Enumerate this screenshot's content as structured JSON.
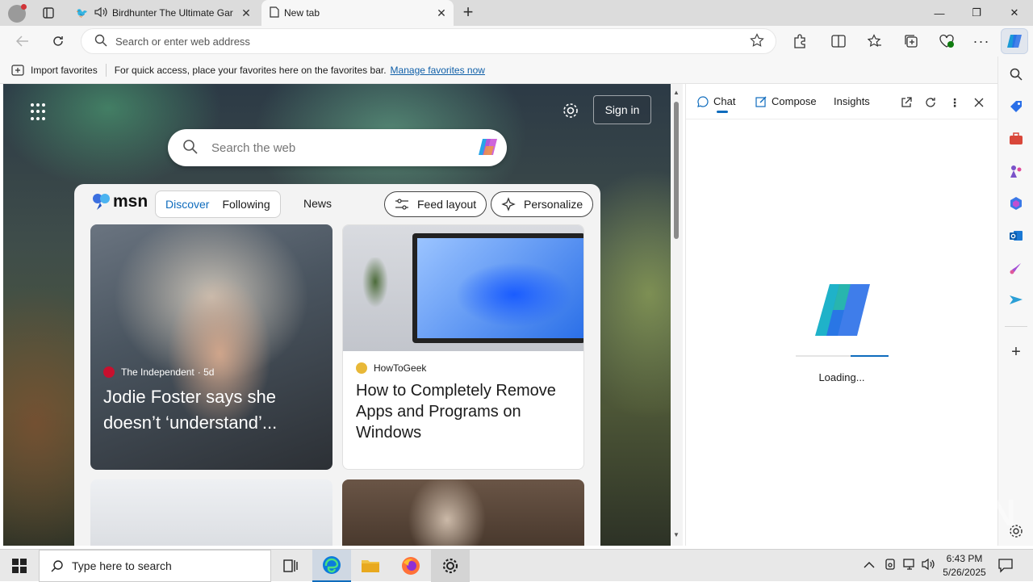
{
  "tabs": [
    {
      "title": "Birdhunter The Ultimate Gar",
      "close": "✕"
    },
    {
      "title": "New tab",
      "close": "✕"
    }
  ],
  "window_controls": {
    "minimize": "—",
    "restore": "❐",
    "close": "✕"
  },
  "new_tab_symbol": "+",
  "address_bar": {
    "placeholder": "Search or enter web address"
  },
  "favorites_bar": {
    "import_label": "Import favorites",
    "hint": "For quick access, place your favorites here on the favorites bar.",
    "manage_link": "Manage favorites now"
  },
  "newtab": {
    "signin": "Sign in",
    "search_placeholder": "Search the web",
    "msn_brand": "msn",
    "tabs": [
      "Discover",
      "Following"
    ],
    "news_tab": "News",
    "feed_layout": "Feed layout",
    "personalize": "Personalize",
    "cards": [
      {
        "source": "The Independent",
        "age": "· 5d",
        "headline": "Jodie Foster says she doesn’t ‘understand’..."
      },
      {
        "source": "HowToGeek",
        "headline": "How to Completely Remove Apps and Programs on Windows"
      }
    ]
  },
  "copilot_pane": {
    "tabs": [
      "Chat",
      "Compose",
      "Insights"
    ],
    "loading_text": "Loading...",
    "loading_progress": 0.41
  },
  "taskbar": {
    "search_placeholder": "Type here to search",
    "time": "6:43 PM",
    "date": "5/26/2025"
  },
  "watermark": "ANY RUN",
  "colors": {
    "accent": "#0f6cbd",
    "tabbar": "#dcdcdc",
    "toolbar": "#f7f7f7",
    "news_source_red": "#c8102e"
  }
}
